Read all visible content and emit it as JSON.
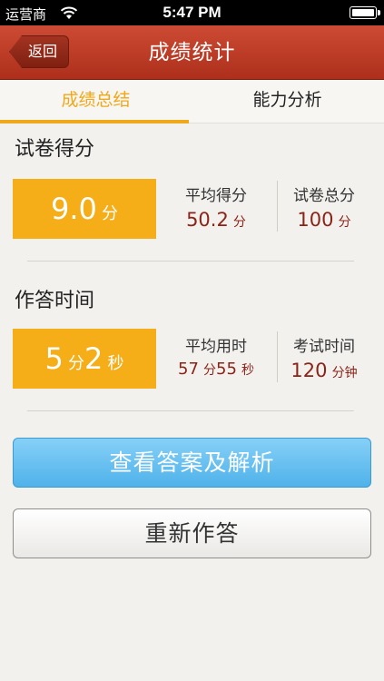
{
  "status_bar": {
    "carrier": "运营商",
    "time": "5:47 PM"
  },
  "nav": {
    "back_label": "返回",
    "title": "成绩统计"
  },
  "tabs": [
    {
      "label": "成绩总结",
      "active": true
    },
    {
      "label": "能力分析",
      "active": false
    }
  ],
  "score_section": {
    "title": "试卷得分",
    "value": "9.0",
    "unit": "分",
    "stats": [
      {
        "label": "平均得分",
        "value": "50.2",
        "unit": "分"
      },
      {
        "label": "试卷总分",
        "value": "100",
        "unit": "分"
      }
    ]
  },
  "time_section": {
    "title": "作答时间",
    "minutes": "5",
    "minutes_unit": "分",
    "seconds": "2",
    "seconds_unit": "秒",
    "stats": [
      {
        "label": "平均用时",
        "v1": "57",
        "u1": "分",
        "v2": "55",
        "u2": "秒"
      },
      {
        "label": "考试时间",
        "v1": "120",
        "u1": "分钟"
      }
    ]
  },
  "buttons": {
    "view_answers": "查看答案及解析",
    "retry": "重新作答"
  },
  "colors": {
    "accent": "#f5ad18",
    "nav_red": "#b83622",
    "value_red": "#8b2418",
    "primary_blue": "#5bb8ee"
  }
}
